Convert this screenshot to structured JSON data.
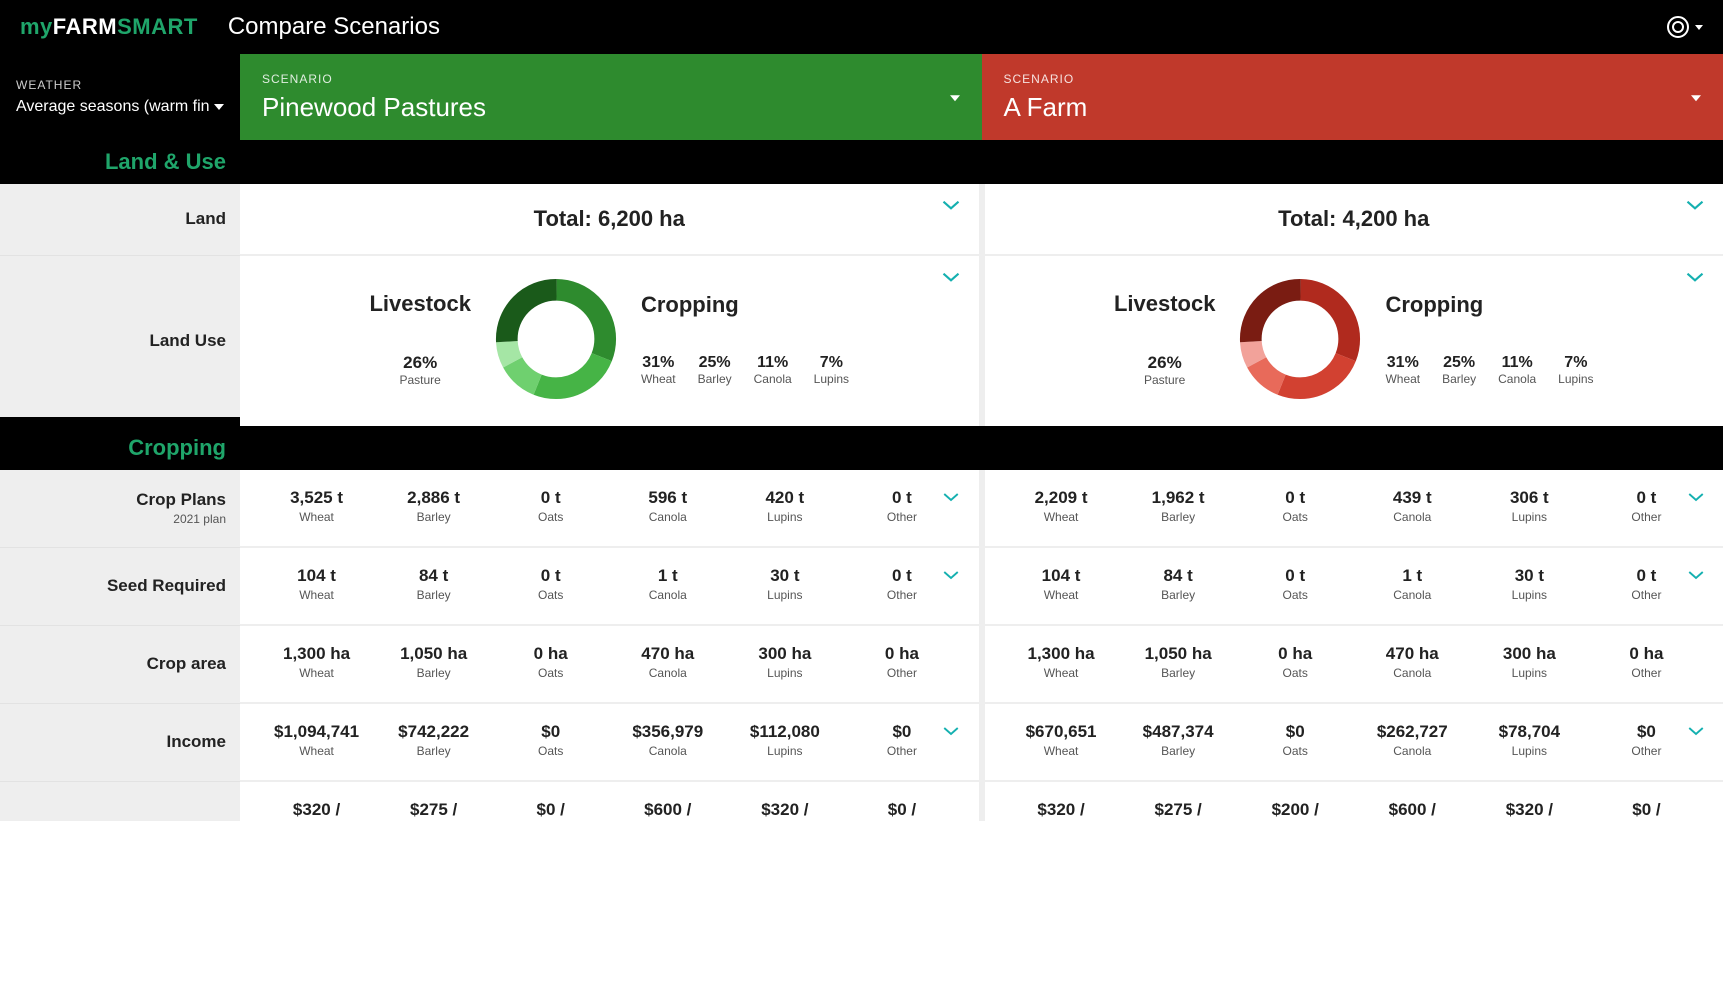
{
  "brand": {
    "my": "my",
    "farm": "FARM",
    "smart": "SMART"
  },
  "page_title": "Compare Scenarios",
  "weather": {
    "label": "WEATHER",
    "value": "Average seasons (warm fin"
  },
  "scenarios": {
    "left": {
      "label": "SCENARIO",
      "name": "Pinewood Pastures",
      "color": "green"
    },
    "right": {
      "label": "SCENARIO",
      "name": "A Farm",
      "color": "red"
    }
  },
  "sections": {
    "land_use_title": "Land & Use",
    "cropping_title": "Cropping"
  },
  "land": {
    "row_label": "Land",
    "left_total": "Total: 6,200 ha",
    "right_total": "Total: 4,200 ha"
  },
  "landuse": {
    "row_label": "Land Use",
    "livestock_head": "Livestock",
    "cropping_head": "Cropping",
    "left": {
      "pasture_pct": "26%",
      "pasture_lbl": "Pasture",
      "crops": [
        {
          "p": "31%",
          "l": "Wheat"
        },
        {
          "p": "25%",
          "l": "Barley"
        },
        {
          "p": "11%",
          "l": "Canola"
        },
        {
          "p": "7%",
          "l": "Lupins"
        }
      ]
    },
    "right": {
      "pasture_pct": "26%",
      "pasture_lbl": "Pasture",
      "crops": [
        {
          "p": "31%",
          "l": "Wheat"
        },
        {
          "p": "25%",
          "l": "Barley"
        },
        {
          "p": "11%",
          "l": "Canola"
        },
        {
          "p": "7%",
          "l": "Lupins"
        }
      ]
    }
  },
  "chart_data": [
    {
      "type": "pie",
      "title": "Land Use — Pinewood Pastures",
      "series": [
        {
          "name": "Pasture",
          "value": 26
        },
        {
          "name": "Wheat",
          "value": 31
        },
        {
          "name": "Barley",
          "value": 25
        },
        {
          "name": "Canola",
          "value": 11
        },
        {
          "name": "Lupins",
          "value": 7
        }
      ],
      "colors": [
        "#1a5a1a",
        "#2e8b2e",
        "#46b446",
        "#6fd06f",
        "#a5e6a5"
      ]
    },
    {
      "type": "pie",
      "title": "Land Use — A Farm",
      "series": [
        {
          "name": "Pasture",
          "value": 26
        },
        {
          "name": "Wheat",
          "value": 31
        },
        {
          "name": "Barley",
          "value": 25
        },
        {
          "name": "Canola",
          "value": 11
        },
        {
          "name": "Lupins",
          "value": 7
        }
      ],
      "colors": [
        "#7a1c12",
        "#b02a1e",
        "#d24131",
        "#e86a5a",
        "#f2a29a"
      ]
    }
  ],
  "crop_categories": [
    "Wheat",
    "Barley",
    "Oats",
    "Canola",
    "Lupins",
    "Other"
  ],
  "cropping": {
    "rows": [
      {
        "label": "Crop Plans",
        "sub": "2021 plan",
        "left": [
          "3,525 t",
          "2,886 t",
          "0 t",
          "596 t",
          "420 t",
          "0 t"
        ],
        "right": [
          "2,209 t",
          "1,962 t",
          "0 t",
          "439 t",
          "306 t",
          "0 t"
        ]
      },
      {
        "label": "Seed Required",
        "sub": "",
        "left": [
          "104 t",
          "84 t",
          "0 t",
          "1 t",
          "30 t",
          "0 t"
        ],
        "right": [
          "104 t",
          "84 t",
          "0 t",
          "1 t",
          "30 t",
          "0 t"
        ]
      },
      {
        "label": "Crop area",
        "sub": "",
        "left": [
          "1,300 ha",
          "1,050 ha",
          "0 ha",
          "470 ha",
          "300 ha",
          "0 ha"
        ],
        "right": [
          "1,300 ha",
          "1,050 ha",
          "0 ha",
          "470 ha",
          "300 ha",
          "0 ha"
        ]
      },
      {
        "label": "Income",
        "sub": "",
        "left": [
          "$1,094,741",
          "$742,222",
          "$0",
          "$356,979",
          "$112,080",
          "$0"
        ],
        "right": [
          "$670,651",
          "$487,374",
          "$0",
          "$262,727",
          "$78,704",
          "$0"
        ]
      }
    ],
    "partial": {
      "label": "",
      "left": [
        "$320 /",
        "$275 /",
        "$0 /",
        "$600 /",
        "$320 /",
        "$0 /"
      ],
      "right": [
        "$320 /",
        "$275 /",
        "$200 /",
        "$600 /",
        "$320 /",
        "$0 /"
      ]
    }
  }
}
